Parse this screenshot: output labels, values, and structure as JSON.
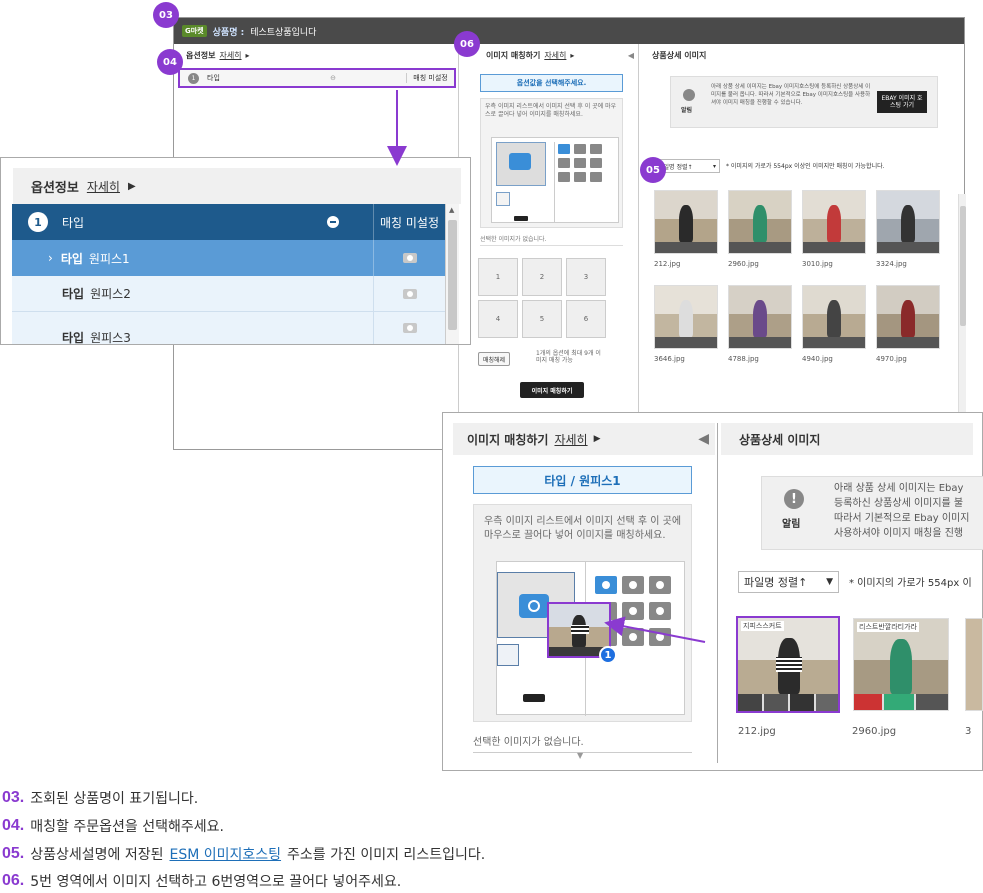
{
  "window": {
    "badge": "G마켓",
    "title_label": "상품명 :",
    "title_value": "테스트상품입니다",
    "option_header": "옵션정보",
    "detail_link": "자세히",
    "option_row_num": "1",
    "option_row_label": "타입",
    "option_row_status": "매칭 미설정",
    "match_header": "이미지 매칭하기",
    "match_select_prompt": "옵션값을 선택해주세요.",
    "match_drop_text": "우측 이미지 리스트에서 이미지 선택 후 이 곳에 마우스로 끌어다 넣어 이미지를 매칭하세요.",
    "match_no_selection": "선택한 이미지가 없습니다.",
    "slots": [
      "1",
      "2",
      "3",
      "4",
      "5",
      "6"
    ],
    "unmatch_button": "매칭해제",
    "limit_note": "1개의 옵션에 최대 9개 이미지 매칭 가능",
    "do_match_button": "이미지 매칭하기",
    "detail_images_header": "상품상세 이미지",
    "alert_label": "알림",
    "alert_text": "아래 상품 상세 이미지는 Ebay 이미지호스팅에 등록하신 상품상세 이미지를 불러 옵니다. 따라서 기본적으로 Ebay 이미지호스팅을 사용하셔야 이미지 매칭을 진행할 수 있습니다.",
    "hosting_button": "EBAY 이미지 호스팅 가기",
    "sort_label": "파일명 정렬↑",
    "size_note": "* 이미지의 가로가 554px 이상인 이미지만 매칭이 가능합니다.",
    "images": [
      "212.jpg",
      "2960.jpg",
      "3010.jpg",
      "3324.jpg",
      "3646.jpg",
      "4788.jpg",
      "4940.jpg",
      "4970.jpg"
    ]
  },
  "zoom_option": {
    "header": "옵션정보",
    "detail_link": "자세히",
    "rows": [
      {
        "num": "1",
        "label": "타입",
        "status": "매칭 미설정"
      },
      {
        "prefix": "›",
        "label": "타입",
        "value": "원피스1"
      },
      {
        "label": "타입",
        "value": "원피스2"
      },
      {
        "label": "타입",
        "value": "원피스3"
      }
    ]
  },
  "zoom_match": {
    "header": "이미지 매칭하기",
    "detail_link": "자세히",
    "selected_option": "타입 / 원피스1",
    "drop_text": "우측 이미지 리스트에서 이미지 선택 후 이 곳에 마우스로 끌어다 넣어 이미지를 매칭하세요.",
    "no_selection": "선택한 이미지가 없습니다.",
    "right_header": "상품상세 이미지",
    "alert_label": "알림",
    "alert_text_1": "아래 상품 상세 이미지는 Ebay",
    "alert_text_2": "등록하신 상품상세 이미지를 불",
    "alert_text_3": "따라서 기본적으로 Ebay 이미지",
    "alert_text_4": "사용하셔야 이미지 매칭을 진행",
    "sort_label": "파일명 정렬↑",
    "size_note": "* 이미지의 가로가 554px 이",
    "thumb_text_1": "지피스스커트",
    "thumb_text_2": "리스트반깔라티가라",
    "images": [
      "212.jpg",
      "2960.jpg",
      "3"
    ],
    "drag_num": "1"
  },
  "badges": [
    "03",
    "04",
    "05",
    "06"
  ],
  "captions": [
    {
      "num": "03.",
      "text": "조회된 상품명이 표기됩니다."
    },
    {
      "num": "04.",
      "text": "매칭할 주문옵션을 선택해주세요."
    },
    {
      "num": "05.",
      "text_before": "상품상세설명에 저장된",
      "link": "ESM 이미지호스팅",
      "text_after": "주소를 가진 이미지 리스트입니다."
    },
    {
      "num": "06.",
      "text": "5번 영역에서 이미지 선택하고 6번영역으로 끌어다 넣어주세요."
    }
  ],
  "colors": {
    "accent": "#8a3ad0",
    "navy": "#1e5a8c",
    "selected": "#5a9bd6",
    "link": "#1e6fb8"
  }
}
